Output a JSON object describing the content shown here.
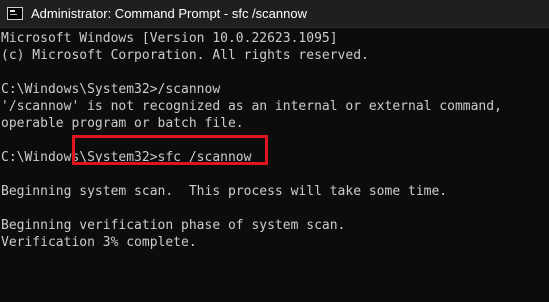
{
  "window": {
    "title": "Administrator: Command Prompt - sfc  /scannow",
    "icon": "command-prompt-icon"
  },
  "console": {
    "lines": [
      "Microsoft Windows [Version 10.0.22623.1095]",
      "(c) Microsoft Corporation. All rights reserved.",
      "",
      "C:\\Windows\\System32>/scannow",
      "'/scannow' is not recognized as an internal or external command,",
      "operable program or batch file.",
      "",
      "C:\\Windows\\System32>sfc /scannow",
      "",
      "Beginning system scan.  This process will take some time.",
      "",
      "Beginning verification phase of system scan.",
      "Verification 3% complete."
    ]
  },
  "annotation": {
    "color": "#e0141e"
  }
}
